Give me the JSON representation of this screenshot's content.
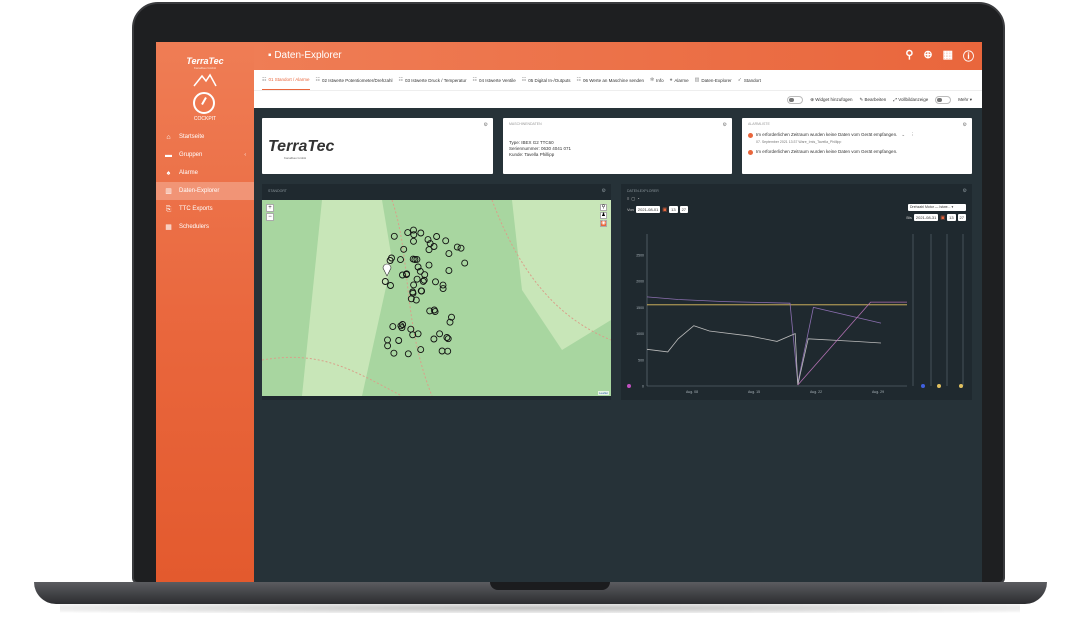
{
  "sidebar": {
    "logo": "TerraTec",
    "logo_sub": "Kanalbau GmbH",
    "cockpit": "COCKPIT",
    "items": [
      {
        "label": "Startseite",
        "icon": "home-icon"
      },
      {
        "label": "Gruppen",
        "icon": "folder-icon"
      },
      {
        "label": "Alarme",
        "icon": "bell-icon"
      },
      {
        "label": "Daten-Explorer",
        "icon": "chart-icon"
      },
      {
        "label": "TTC Exports",
        "icon": "export-icon"
      },
      {
        "label": "Schedulers",
        "icon": "calendar-icon"
      }
    ]
  },
  "header": {
    "title": "Daten-Explorer"
  },
  "tabs": [
    "01 Standort / Alarme",
    "02 Istwerte Potentiometer/Drehzahl",
    "03 Istwerte Druck / Temperatur",
    "04 Istwerte Ventile",
    "05 Digital In-/Outputs",
    "06 Werte an Maschine senden",
    "Info",
    "Alarme",
    "Daten-Explorer",
    "Standort"
  ],
  "toolbar": {
    "add_widget": "Widget hinzufügen",
    "edit": "Bearbeiten",
    "fullscreen": "Vollbildanzeige",
    "more": "Mehr"
  },
  "logo_card": {
    "brand": "TerraTec",
    "brand_sub": "Kanalbau GmbH"
  },
  "machine_card": {
    "title": "MASCHINENDATEN",
    "type": "Type: IBEX G2 TTC60",
    "serial": "Seriennummer: 0630 4041 071",
    "customer": "Kunde: Tavella Phillipp"
  },
  "alarm_card": {
    "title": "ALARMLISTE",
    "alarm_text": "Im erforderlichen Zeitraum wurden keine Daten vom Gerät empfangen.",
    "alarm_meta": "07. September 2021 13:37   Ware_Irnis_Tavella_Phillipp",
    "alarm_text2": "Im erforderlichen Zeitraum wurden keine Daten vom Gerät empfangen."
  },
  "map_card": {
    "title": "STANDORT",
    "attribution": "Leaflet"
  },
  "explorer_card": {
    "title": "DATEN-EXPLORER",
    "from_label": "Von",
    "from_date": "2021-08-01",
    "from_h": "13",
    "from_m": "27",
    "to_label": "Bis",
    "to_date": "2021-08-31",
    "to_h": "13",
    "to_m": "27",
    "select": "Drehzahl Motor — Istwe..."
  },
  "chart_data": {
    "type": "line",
    "x_ticks": [
      "Aug. 08",
      "Aug. 15",
      "Aug. 22",
      "Aug. 29"
    ],
    "y_ticks": [
      0,
      500,
      1000,
      1500,
      2000,
      2500
    ],
    "ylim": [
      0,
      2900
    ],
    "series": [
      {
        "color": "#e0c060",
        "values": [
          [
            0.0,
            1550
          ],
          [
            0.25,
            1550
          ],
          [
            0.5,
            1550
          ],
          [
            0.75,
            1550
          ],
          [
            1.0,
            1550
          ]
        ]
      },
      {
        "color": "#8b6fb0",
        "values": [
          [
            0.0,
            1700
          ],
          [
            0.12,
            1650
          ],
          [
            0.3,
            1610
          ],
          [
            0.55,
            1580
          ],
          [
            0.58,
            60
          ],
          [
            0.64,
            1500
          ],
          [
            0.9,
            1200
          ]
        ]
      },
      {
        "color": "#bbbbbb",
        "values": [
          [
            0.0,
            700
          ],
          [
            0.08,
            650
          ],
          [
            0.12,
            900
          ],
          [
            0.18,
            1150
          ],
          [
            0.24,
            1050
          ],
          [
            0.4,
            950
          ],
          [
            0.5,
            850
          ],
          [
            0.57,
            1000
          ],
          [
            0.58,
            20
          ],
          [
            0.62,
            900
          ],
          [
            0.8,
            850
          ],
          [
            0.9,
            820
          ]
        ]
      },
      {
        "color": "#b06fb0",
        "values": [
          [
            0.58,
            20
          ],
          [
            0.86,
            1600
          ],
          [
            1.0,
            1600
          ]
        ]
      }
    ]
  }
}
